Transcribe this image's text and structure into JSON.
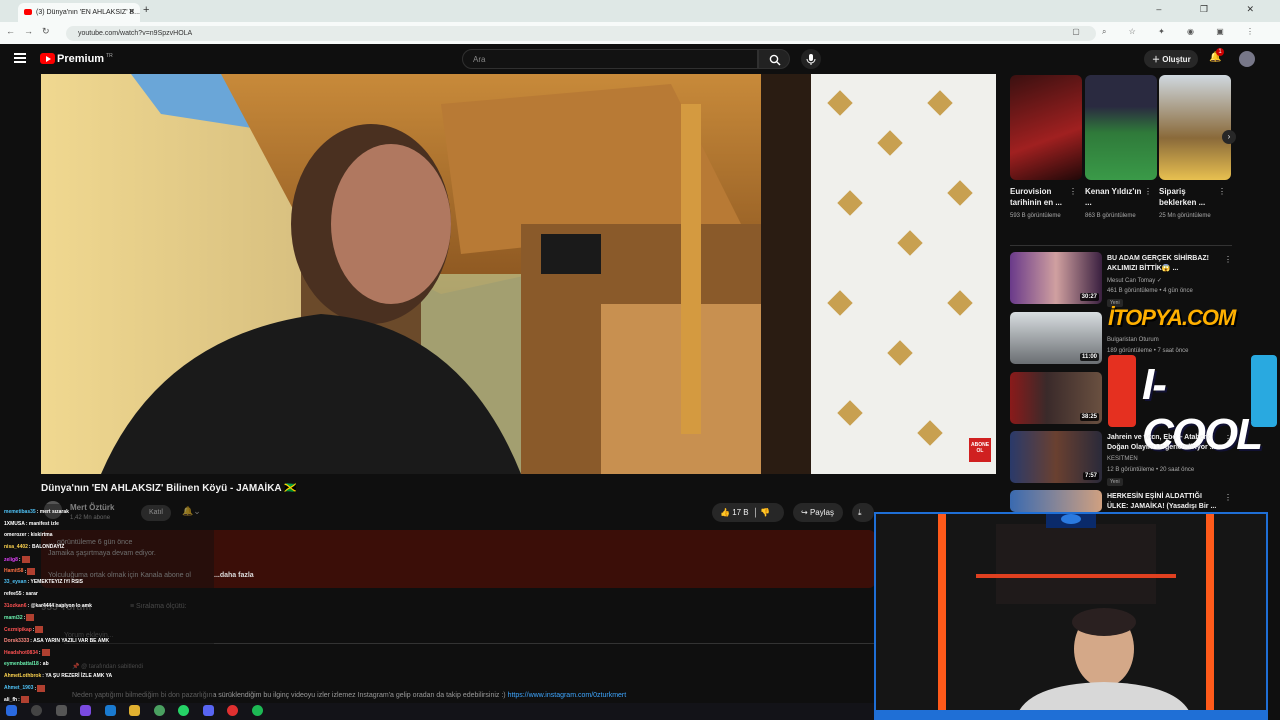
{
  "browser": {
    "tab_title": "(3) Dünya'nın 'EN AHLAKSIZ' B...",
    "url": "youtube.com/watch?v=n9SpzvHOLA",
    "window_controls": "– ❐ ✕"
  },
  "youtube": {
    "brand": "Premium",
    "region": "TR",
    "search_placeholder": "Ara",
    "create_label": "Oluştur",
    "notification_count": "1"
  },
  "video": {
    "title": "Dünya'nın 'EN AHLAKSIZ' Bilinen Köyü - JAMAİKA 🇯🇲",
    "channel": "Mert Öztürk",
    "subscribers": "1,42 Mn abone",
    "join_label": "Katıl",
    "likes": "17 B",
    "share_label": "Paylaş",
    "overlay_badge": "ABONE OL"
  },
  "description": {
    "meta": "… görüntüleme  6 gün önce",
    "line1": "Jamaika şaşırtmaya devam ediyor.",
    "line2": "Yolculuğuma ortak olmak için Kanala abone ol",
    "more": "...daha fazla"
  },
  "comments": {
    "count_label": "955 Yorum",
    "sort_label": "Sıralama ölçütü:",
    "add_placeholder": "Yorum ekleyin...",
    "pinned_by": "@ tarafından sabitlendi",
    "pinned_text": "Neden yaptığımı bilmediğim bi don pazarlığına sürüklendiğim bu ilginç videoyu izler izlemez Instagram'a gelip oradan da takip edebilirsiniz :) ",
    "pinned_link": "https://www.instagram.com/0zturkmert"
  },
  "chat": [
    {
      "user": "memetibas35",
      "text": ": mert sızarak",
      "color": "#4fc3f7"
    },
    {
      "user": "1XMUSA",
      "text": ": manifest izle",
      "color": "#ffffff"
    },
    {
      "user": "omerozer",
      "text": ": kiskirtma",
      "color": "#ffffff"
    },
    {
      "user": "nisa_4402",
      "text": ": BALONDAYIZ",
      "color": "#ffd54f"
    },
    {
      "user": "zelig8",
      "text": ":",
      "color": "#e040fb"
    },
    {
      "user": "Hamit58",
      "text": ":",
      "color": "#ff7043"
    },
    {
      "user": "33_eysan",
      "text": ": YEMEKTEYIZ IYI RSIS",
      "color": "#4fc3f7"
    },
    {
      "user": "refee55",
      "text": ": sarar",
      "color": "#ffffff"
    },
    {
      "user": "31ozkan6",
      "text": ": @kar4444 napiyon lo amk",
      "color": "#ff5252"
    },
    {
      "user": "mami32",
      "text": ":",
      "color": "#69f0ae"
    },
    {
      "user": "Cezmipikap",
      "text": ":",
      "color": "#ff5252"
    },
    {
      "user": "Dorsk3333",
      "text": ": ASA YARIN YAZILI VAR BE AMK",
      "color": "#ff8a80"
    },
    {
      "user": "Headshot0834",
      "text": ":",
      "color": "#ff5252"
    },
    {
      "user": "eymenbattal18",
      "text": ": ab",
      "color": "#69f0ae"
    },
    {
      "user": "AhmetLothbrok",
      "text": ": YA ŞU REZERİ İZLE AMK YA",
      "color": "#ffd54f"
    },
    {
      "user": "Ahmet_1903",
      "text": ":",
      "color": "#4fc3f7"
    },
    {
      "user": "ali_fh",
      "text": ":",
      "color": "#ffffff"
    }
  ],
  "shorts": [
    {
      "title": "Eurovision tarihinin en ...",
      "views": "593 B görüntüleme"
    },
    {
      "title": "Kenan Yıldız'ın ...",
      "views": "863 B görüntüleme"
    },
    {
      "title": "Sipariş beklerken ...",
      "views": "25 Mn görüntüleme"
    }
  ],
  "recommended": [
    {
      "title": "BU ADAM GERÇEK SİHİRBAZ! AKLIMIZI BİTTİK😱 ...",
      "channel": "Mesut Can Tomay ✓",
      "meta": "461 B görüntüleme • 4 gün önce",
      "duration": "30:27",
      "badge": "Yeni"
    },
    {
      "title": "",
      "channel": "Bulgaristan Oturum",
      "meta": "189 görüntüleme • 7 saat önce",
      "duration": "11:00",
      "badge": ""
    },
    {
      "title": "",
      "channel": "",
      "meta": "",
      "duration": "38:25",
      "badge": ""
    },
    {
      "title": "Jahrein ve wtcn, Ebo – Ataberk Doğan Olayını Değerlendiriyor ...",
      "channel": "KESITMEN",
      "meta": "12 B görüntüleme • 20 saat önce",
      "duration": "7:57",
      "badge": "Yeni"
    },
    {
      "title": "HERKESİN EŞİNİ ALDATTIĞI ÜLKE: JAMAİKA! (Yasadışı Bir ...",
      "channel": "",
      "meta": "",
      "duration": "",
      "badge": ""
    }
  ],
  "overlays": {
    "itopya": "İTOPYA.COM",
    "icool": "I-COOL"
  }
}
